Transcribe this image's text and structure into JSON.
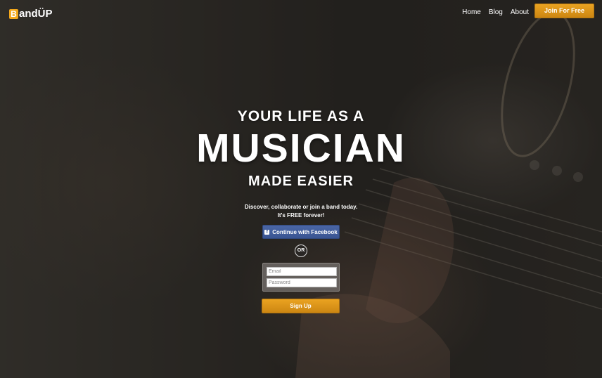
{
  "brand": {
    "logo_letter": "B",
    "logo_rest": "andÜP",
    "accent": "#f3a81b"
  },
  "nav": {
    "items": [
      {
        "label": "Home"
      },
      {
        "label": "Blog"
      },
      {
        "label": "About"
      }
    ],
    "join_label": "Join For Free"
  },
  "hero": {
    "line1": "YOUR LIFE AS A",
    "line2": "MUSICIAN",
    "line3": "MADE EASIER",
    "tagline1": "Discover, collaborate or join a band today.",
    "tagline2": "It's FREE forever!"
  },
  "signup": {
    "facebook_icon": "f",
    "facebook_label": "Continue with Facebook",
    "or_label": "OR",
    "email_placeholder": "Email",
    "password_placeholder": "Password",
    "signup_label": "Sign Up"
  },
  "colors": {
    "button_gold": "#e09a1c",
    "facebook_blue": "#3b5998"
  }
}
